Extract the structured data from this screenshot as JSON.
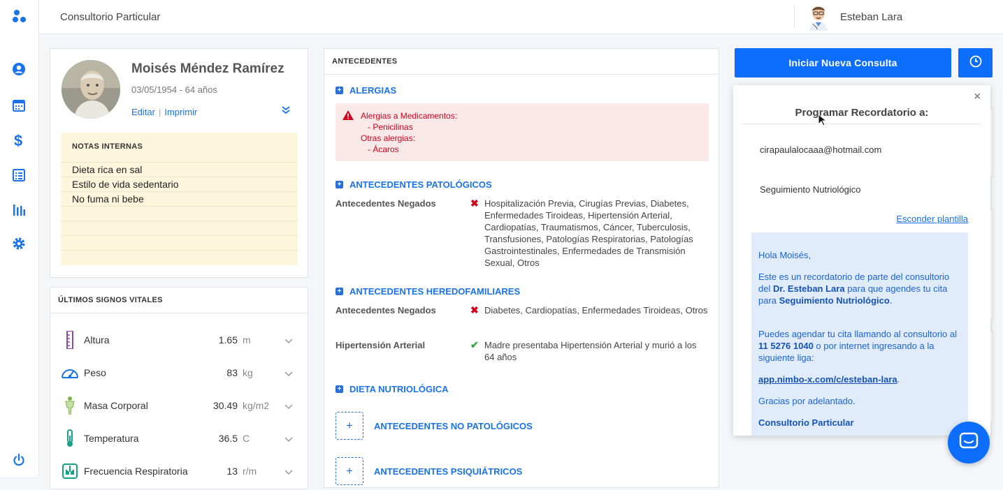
{
  "app": {
    "title": "Consultorio Particular",
    "user_name": "Esteban Lara"
  },
  "sidebar": {
    "items": [
      "logo-icon",
      "patient-icon",
      "calendar-icon",
      "dollar-icon",
      "list-icon",
      "stats-icon",
      "settings-icon",
      "power-icon"
    ]
  },
  "patient": {
    "name": "Moisés Méndez Ramírez",
    "dob": "03/05/1954 - 64 años",
    "edit_label": "Editar",
    "separator": "|",
    "print_label": "Imprimir"
  },
  "notes": {
    "title": "NOTAS INTERNAS",
    "lines": [
      "Dieta rica en sal",
      "Estilo de vida sedentario",
      "No fuma ni bebe",
      "",
      "",
      "",
      ""
    ]
  },
  "vitals": {
    "title": "ÚLTIMOS SIGNOS VITALES",
    "rows": [
      {
        "label": "Altura",
        "value": "1.65",
        "unit": "m",
        "icon": "ruler-icon",
        "color": "#8e44ad"
      },
      {
        "label": "Peso",
        "value": "83",
        "unit": "kg",
        "icon": "scale-icon",
        "color": "#1a73e8"
      },
      {
        "label": "Masa Corporal",
        "value": "30.49",
        "unit": "kg/m2",
        "icon": "body-icon",
        "color": "#7cb342"
      },
      {
        "label": "Temperatura",
        "value": "36.5",
        "unit": "C",
        "icon": "thermometer-icon",
        "color": "#16a085"
      },
      {
        "label": "Frecuencia Respiratoria",
        "value": "13",
        "unit": "r/m",
        "icon": "lungs-icon",
        "color": "#16a085"
      }
    ]
  },
  "antecedentes": {
    "title": "ANTECEDENTES",
    "alergias": {
      "title": "ALERGIAS",
      "lines": [
        "Alergias a Medicamentos:",
        "   - Penicilinas",
        "Otras alergias:",
        "   - Ácaros"
      ]
    },
    "patologicos": {
      "title": "ANTECEDENTES PATOLÓGICOS",
      "label": "Antecedentes Negados",
      "mark": "✖",
      "text": "Hospitalización Previa, Cirugías Previas, Diabetes, Enfermedades Tiroideas, Hipertensión Arterial, Cardiopatías, Traumatismos, Cáncer, Tuberculosis, Transfusiones, Patologías Respiratorias, Patologías Gastrointestinales, Enfermedades de Transmisión Sexual, Otros"
    },
    "heredofamiliares": {
      "title": "ANTECEDENTES HEREDOFAMILIARES",
      "rows": [
        {
          "label": "Antecedentes Negados",
          "mark": "✖",
          "text": "Diabetes, Cardiopatías, Enfermedades Tiroideas, Otros"
        },
        {
          "label": "Hipertensión Arterial",
          "mark": "✔",
          "text": "Madre presentaba Hipertensión Arterial y murió a los 64 años"
        }
      ]
    },
    "dieta": {
      "title": "DIETA NUTRIOLÓGICA"
    },
    "no_patologicos": {
      "button": "+",
      "title": "ANTECEDENTES NO PATOLÓGICOS"
    },
    "psiquiatricos": {
      "button": "+",
      "title": "ANTECEDENTES PSIQUIÁTRICOS"
    }
  },
  "actions": {
    "new_consult": "Iniciar Nueva Consulta"
  },
  "reminder": {
    "close": "×",
    "title": "Programar Recordatorio a:",
    "email": "cirapaulalocaaa@hotmail.com",
    "reason": "Seguimiento Nutriológico",
    "hide_template": "Esconder plantilla",
    "template": {
      "greeting": "Hola Moisés,",
      "p1_a": "Este es un recordatorio de parte del consultorio del ",
      "p1_doctor": "Dr. Esteban Lara",
      "p1_b": " para que agendes tu cita para ",
      "p1_reason": "Seguimiento Nutriológico",
      "p1_c": ".",
      "p2_a": "Puedes agendar tu cita llamando al consultorio al ",
      "p2_phone": "11 5276 1040",
      "p2_b": " o por internet ingresando a la siguiente liga:",
      "link": "app.nimbo-x.com/c/esteban-lara",
      "link_dot": ".",
      "thanks": "Gracias por adelantado.",
      "signature": "Consultorio Particular"
    }
  },
  "colors": {
    "primary": "#0d6efd",
    "danger": "#d0021b",
    "success": "#2eaa3a",
    "notes_bg": "#fdf5dc"
  }
}
